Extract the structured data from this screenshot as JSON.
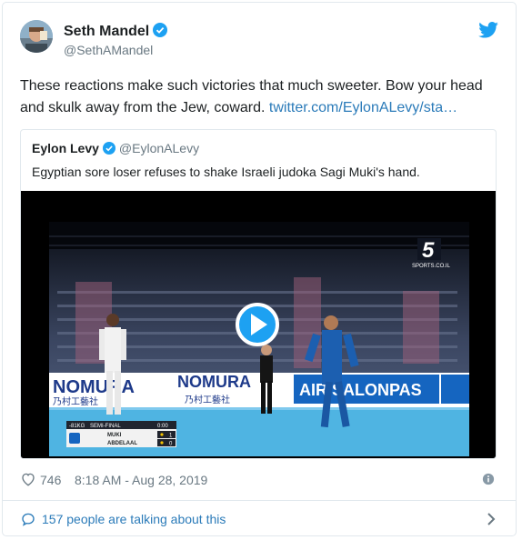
{
  "author": {
    "name": "Seth Mandel",
    "handle": "@SethAMandel"
  },
  "tweet": {
    "text": "These reactions make such victories that much sweeter. Bow your head and skulk away from the Jew, coward. ",
    "link_text": "twitter.com/EylonALevy/sta…"
  },
  "quote": {
    "name": "Eylon Levy",
    "handle": "@EylonALevy",
    "text": "Egyptian sore loser refuses to shake Israeli judoka Sagi Muki's hand."
  },
  "video": {
    "channel_number": "5",
    "channel_sub": "SPORTS.CO.IL",
    "banners": [
      "NOMURA",
      "NOMURA",
      "AIR SALONPAS"
    ],
    "banner_sub": "乃村工藝社",
    "scoreboard": {
      "category": "-81KG",
      "round": "SEMI-FINAL",
      "clock": "0:00",
      "player1": "MUKI",
      "player2": "ABDELAAL",
      "score1": "1",
      "score2": "0"
    }
  },
  "meta": {
    "likes": "746",
    "time": "8:18 AM - Aug 28, 2019"
  },
  "footer": {
    "talking": "157 people are talking about this"
  },
  "colors": {
    "link": "#2b7bb9",
    "verified": "#1da1f2",
    "muted": "#697882",
    "mat_blue": "#4fb4e2"
  }
}
